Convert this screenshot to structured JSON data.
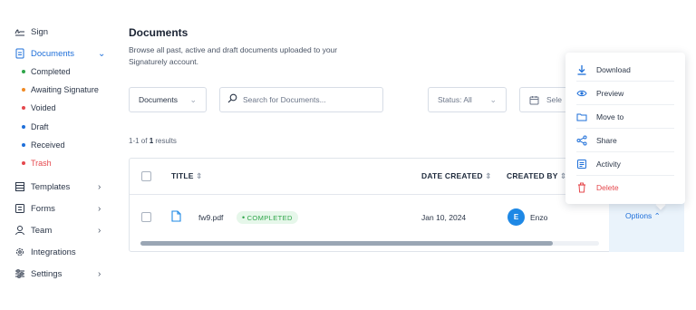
{
  "sidebar": {
    "items": [
      {
        "label": "Sign",
        "icon": "signature-icon"
      },
      {
        "label": "Documents",
        "icon": "document-icon",
        "active": true
      },
      {
        "label": "Templates",
        "icon": "template-icon"
      },
      {
        "label": "Forms",
        "icon": "form-icon"
      },
      {
        "label": "Team",
        "icon": "user-icon"
      },
      {
        "label": "Integrations",
        "icon": "gear-icon"
      },
      {
        "label": "Settings",
        "icon": "sliders-icon"
      }
    ],
    "documents_sub": [
      {
        "label": "Completed",
        "color": "#2fa64a"
      },
      {
        "label": "Awaiting Signature",
        "color": "#f08a24"
      },
      {
        "label": "Voided",
        "color": "#e5484d"
      },
      {
        "label": "Draft",
        "color": "#1e6fd9"
      },
      {
        "label": "Received",
        "color": "#1e6fd9"
      },
      {
        "label": "Trash",
        "color": "#e5484d"
      }
    ]
  },
  "header": {
    "title": "Documents",
    "subtitle": "Browse all past, active and draft documents uploaded to your Signaturely account."
  },
  "filters": {
    "type_value": "Documents",
    "search_placeholder": "Search for Documents...",
    "status_value": "Status: All",
    "date_value": "Sele"
  },
  "results": {
    "range": "1-1 of ",
    "count": "1",
    "suffix": " results"
  },
  "table": {
    "columns": {
      "title": "TITLE",
      "date_created": "DATE CREATED",
      "created_by": "CREATED BY"
    },
    "rows": [
      {
        "filename": "fw9.pdf",
        "status": "COMPLETED",
        "date": "Jan 10, 2024",
        "creator": "Enzo",
        "creator_initial": "E",
        "options_label": "Options"
      }
    ],
    "scroll_fraction": 0.9
  },
  "menu": {
    "items": [
      {
        "label": "Download",
        "icon": "download-icon"
      },
      {
        "label": "Preview",
        "icon": "eye-icon"
      },
      {
        "label": "Move to",
        "icon": "folder-icon"
      },
      {
        "label": "Share",
        "icon": "share-icon"
      },
      {
        "label": "Activity",
        "icon": "activity-icon"
      },
      {
        "label": "Delete",
        "icon": "trash-icon",
        "danger": true
      }
    ]
  },
  "colors": {
    "accent": "#1e6fd9",
    "success": "#2fa64a",
    "danger": "#e5484d",
    "warning": "#f08a24"
  }
}
